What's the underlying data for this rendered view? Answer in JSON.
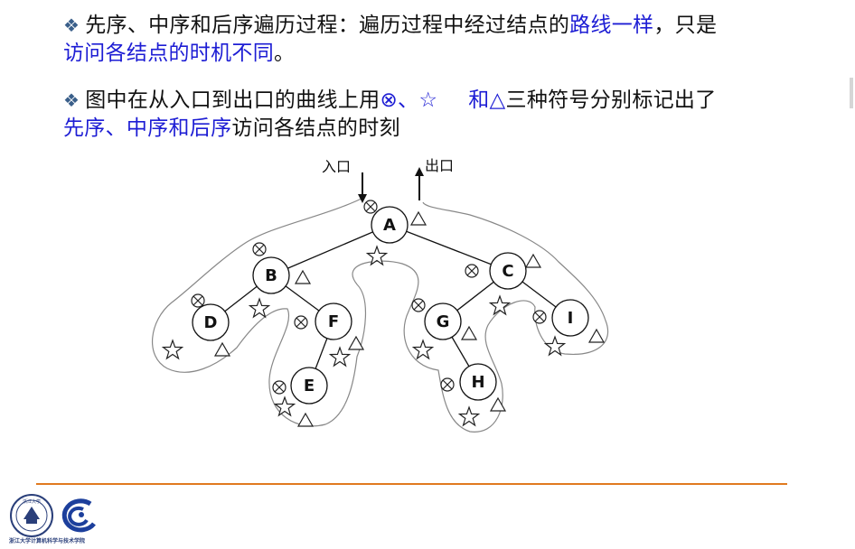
{
  "colors": {
    "highlight": "#1d1dd4",
    "bullet": "#3a5f8a",
    "footer_rule": "#e07a1f"
  },
  "text": {
    "bullet": "❖",
    "p1_a": "先序、中序和后序遍历过程：遍历过程中经过结点的",
    "p1_b": "路线一样",
    "p1_c": "，只是",
    "p1_d": "访问各结点的时机不同",
    "p1_e": "。",
    "p2_a": "图中在从入口到出口的曲线上用",
    "p2_sym1": "⊗、",
    "p2_sym2": "☆",
    "p2_sym3": "和△",
    "p2_b": "三种符号分别标记出了",
    "p2_c": "先序、中序和后序",
    "p2_d": "访问各结点的时刻"
  },
  "diagram": {
    "entry_label": "入口",
    "exit_label": "出口",
    "nodes": [
      {
        "id": "A",
        "label": "A"
      },
      {
        "id": "B",
        "label": "B"
      },
      {
        "id": "C",
        "label": "C"
      },
      {
        "id": "D",
        "label": "D"
      },
      {
        "id": "F",
        "label": "F"
      },
      {
        "id": "E",
        "label": "E"
      },
      {
        "id": "G",
        "label": "G"
      },
      {
        "id": "H",
        "label": "H"
      },
      {
        "id": "I",
        "label": "I"
      }
    ],
    "edges": [
      [
        "A",
        "B"
      ],
      [
        "A",
        "C"
      ],
      [
        "B",
        "D"
      ],
      [
        "B",
        "F"
      ],
      [
        "F",
        "E"
      ],
      [
        "C",
        "G"
      ],
      [
        "G",
        "H"
      ],
      [
        "C",
        "I"
      ]
    ]
  },
  "logo": {
    "badge_text": "浙江大学",
    "caption": "浙江大学计算机科学与技术学院"
  },
  "icons": [
    "bullet-diamond-icon",
    "circled-x-icon",
    "star-icon",
    "triangle-icon",
    "entry-arrow-icon",
    "exit-arrow-icon",
    "zju-logo-icon",
    "cs-college-logo-icon"
  ]
}
